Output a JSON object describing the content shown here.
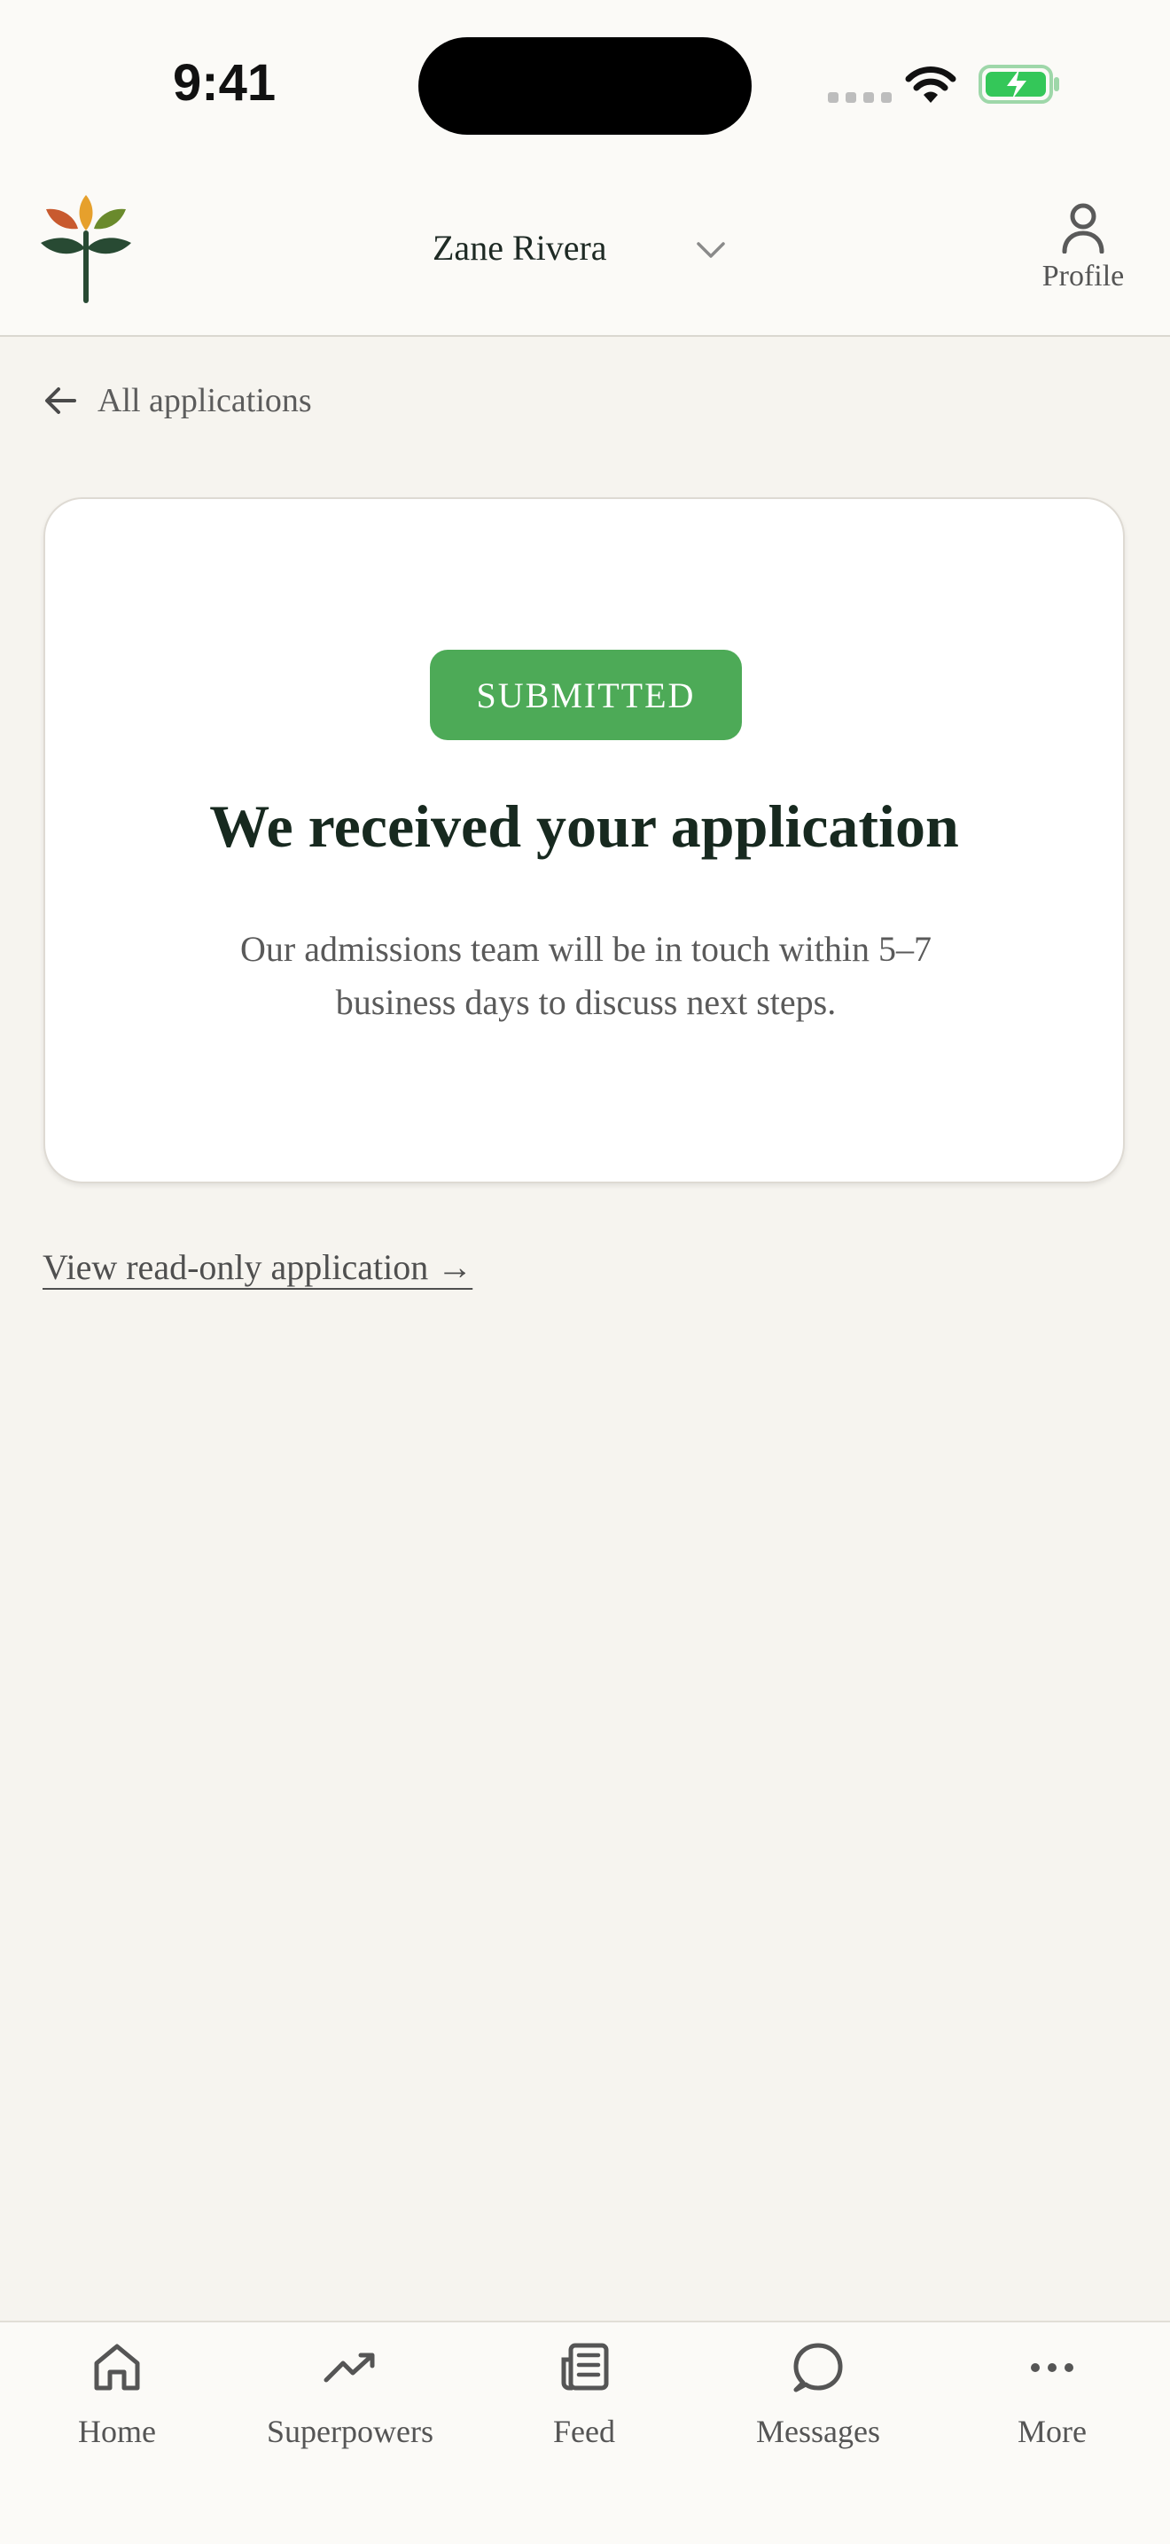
{
  "status_bar": {
    "time": "9:41"
  },
  "header": {
    "user_name": "Zane Rivera",
    "profile_label": "Profile"
  },
  "nav": {
    "back_label": "All applications"
  },
  "card": {
    "badge": "SUBMITTED",
    "title": "We received your application",
    "body": "Our admissions team will be in touch within 5–7 business days to discuss next steps."
  },
  "link": {
    "readonly": "View read-only application →"
  },
  "tabs": [
    {
      "label": "Home",
      "icon": "home-icon"
    },
    {
      "label": "Superpowers",
      "icon": "trending-up-icon"
    },
    {
      "label": "Feed",
      "icon": "newspaper-icon"
    },
    {
      "label": "Messages",
      "icon": "chat-bubble-icon"
    },
    {
      "label": "More",
      "icon": "more-dots-icon"
    }
  ],
  "colors": {
    "background": "#f6f4ef",
    "badge_green": "#4daa57",
    "title_green": "#17291f",
    "battery_green": "#34c759"
  }
}
